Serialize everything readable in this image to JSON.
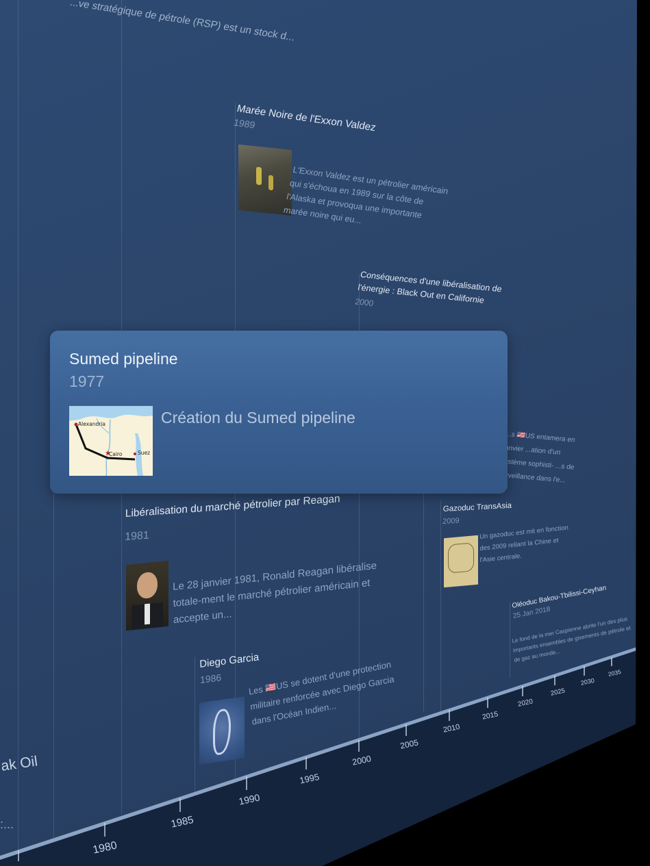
{
  "timeline": {
    "top_event": {
      "description": "...ve stratégique de pétrole (RSP) est un stock d..."
    },
    "events": [
      {
        "title": "Marée Noire de l'Exxon Valdez",
        "year": "1989",
        "description": "L'Exxon Valdez est un pétrolier américain qui s'échoua en 1989 sur la côte de l'Alaska et provoqua une importante marée noire qui eu..."
      },
      {
        "title": "Conséquences d'une libéralisation de l'énergie : Black Out en Californie",
        "year": "2000"
      },
      {
        "title": "Libéralisation du marché pétrolier par Reagan",
        "year": "1981",
        "description": "Le 28 janvier 1981, Ronald Reagan libéralise totale-ment le marché pétrolier américain et accepte un..."
      },
      {
        "title": "Diego Garcia",
        "year": "1986",
        "description": "Les 🇺🇸US se dotent d'une protection militaire renforcée avec Diego Garcia dans l'Océan Indien..."
      },
      {
        "title": "Gazoduc TransAsia",
        "year": "2009",
        "description": "Un gazoduc est mit en fonction des 2009 reliant la Chine et l'Asie centrale."
      },
      {
        "title": "Oléoduc Bakou-Tbilissi-Ceyhan",
        "year": "25 Jan 2018",
        "description": "Le fond de la mer Caspienne abrite l'un des plus importants ensembles de gisements de pétrole et de gaz au monde..."
      }
    ],
    "partial_event": {
      "description": "...s 🇺🇸US entamera en janvier ...ation d'un système sophisti- ...s de surveillance dans l'e..."
    },
    "left_cut_label": "ak Oil",
    "left_cut_desc": ":...",
    "axis_ticks": [
      "1980",
      "1985",
      "1990",
      "1995",
      "2000",
      "2005",
      "2010",
      "2015",
      "2020",
      "2025",
      "2030",
      "2035"
    ]
  },
  "selected_event": {
    "title": "Sumed pipeline",
    "year": "1977",
    "description": "Création du Sumed pipeline",
    "map_labels": [
      "Alexandria",
      "Cairo",
      "Suez"
    ]
  }
}
